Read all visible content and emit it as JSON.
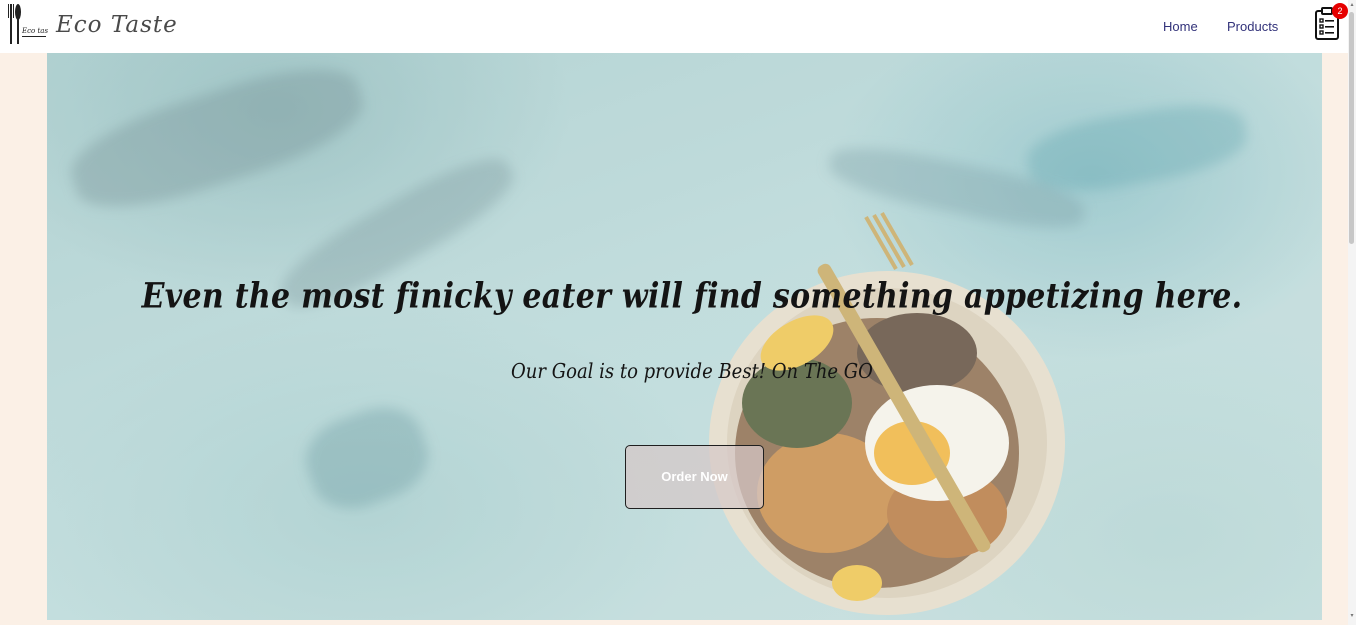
{
  "brand": {
    "logo_text": "Eco taste",
    "name": "Eco Taste"
  },
  "nav": {
    "home_label": "Home",
    "products_label": "Products"
  },
  "cart": {
    "icon": "clipboard-list-icon",
    "count": "2",
    "badge_color": "#e60000"
  },
  "hero": {
    "title": "Even the most finicky eater will find something appetizing here.",
    "subtitle": "Our Goal is to provide Best! On The GO",
    "button_label": "Order Now"
  },
  "colors": {
    "page_background": "#fbf0e6",
    "nav_link": "#32327a",
    "hero_teal": "#a7cccc"
  }
}
